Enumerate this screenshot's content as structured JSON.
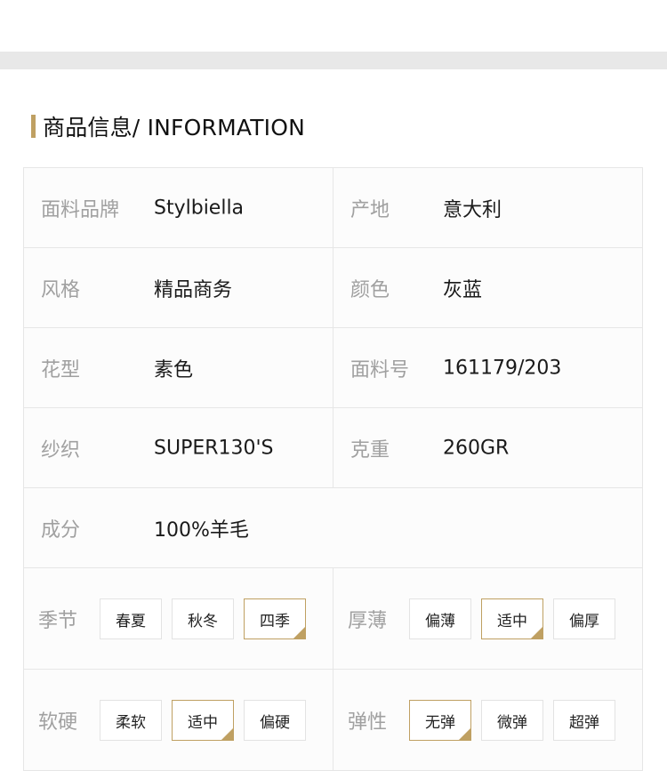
{
  "section": {
    "title": "商品信息/ INFORMATION"
  },
  "accent_color": "#bfa062",
  "rows": [
    {
      "left": {
        "label": "面料品牌",
        "value": "Stylbiella"
      },
      "right": {
        "label": "产地",
        "value": "意大利"
      }
    },
    {
      "left": {
        "label": "风格",
        "value": "精品商务"
      },
      "right": {
        "label": "颜色",
        "value": "灰蓝"
      }
    },
    {
      "left": {
        "label": "花型",
        "value": "素色"
      },
      "right": {
        "label": "面料号",
        "value": "161179/203"
      }
    },
    {
      "left": {
        "label": "纱织",
        "value": "SUPER130'S"
      },
      "right": {
        "label": "克重",
        "value": "260GR"
      }
    }
  ],
  "composition": {
    "label": "成分",
    "value": "100%羊毛"
  },
  "option_rows": [
    {
      "left": {
        "label": "季节",
        "options": [
          "春夏",
          "秋冬",
          "四季"
        ],
        "selected": "四季"
      },
      "right": {
        "label": "厚薄",
        "options": [
          "偏薄",
          "适中",
          "偏厚"
        ],
        "selected": "适中"
      }
    },
    {
      "left": {
        "label": "软硬",
        "options": [
          "柔软",
          "适中",
          "偏硬"
        ],
        "selected": "适中"
      },
      "right": {
        "label": "弹性",
        "options": [
          "无弹",
          "微弹",
          "超弹"
        ],
        "selected": "无弹"
      }
    }
  ]
}
